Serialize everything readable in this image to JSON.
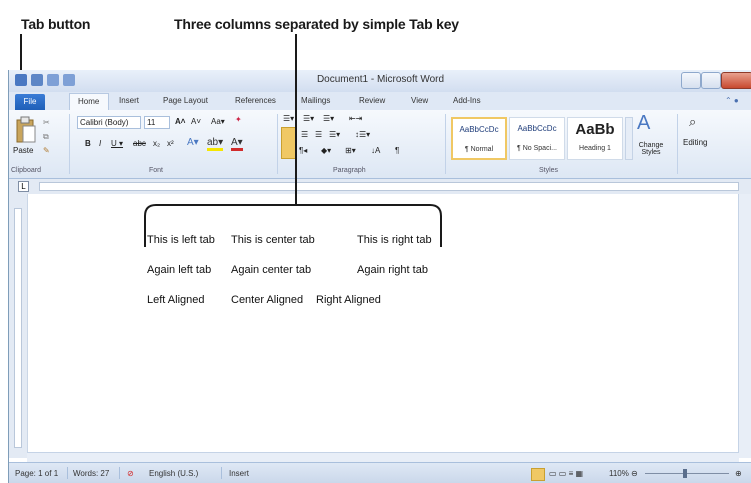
{
  "annotations": {
    "tab_button_label": "Tab button",
    "columns_label": "Three columns separated by simple Tab key"
  },
  "window": {
    "title": "Document1 - Microsoft Word",
    "tabs": [
      "File",
      "Home",
      "Insert",
      "Page Layout",
      "References",
      "Mailings",
      "Review",
      "View",
      "Add-Ins"
    ],
    "active_tab": "Home"
  },
  "ribbon": {
    "clipboard": {
      "paste_label": "Paste",
      "group_label": "Clipboard"
    },
    "font": {
      "font_name": "Calibri (Body)",
      "font_size": "11",
      "group_label": "Font"
    },
    "paragraph": {
      "group_label": "Paragraph"
    },
    "styles": {
      "items": [
        {
          "sample": "AaBbCcDc",
          "name": "¶ Normal"
        },
        {
          "sample": "AaBbCcDc",
          "name": "¶ No Spaci..."
        },
        {
          "sample": "AaBb",
          "name": "Heading 1"
        }
      ],
      "change_styles": "Change Styles",
      "group_label": "Styles"
    },
    "editing": {
      "label": "Editing"
    }
  },
  "document": {
    "rows": [
      [
        "This is left tab",
        "This is center tab",
        "This is right tab"
      ],
      [
        "Again left tab",
        "Again center tab",
        "Again right tab"
      ],
      [
        "Left Aligned",
        "Center Aligned",
        "Right Aligned"
      ]
    ]
  },
  "statusbar": {
    "page": "Page: 1 of 1",
    "words": "Words: 27",
    "language": "English (U.S.)",
    "mode": "Insert",
    "zoom": "110%"
  },
  "colors": {
    "file_tab": "#2a6cc8",
    "ribbon_bg": "#dde7f4",
    "accent_red": "#d12b2b",
    "accent_yellow": "#f0c864"
  }
}
